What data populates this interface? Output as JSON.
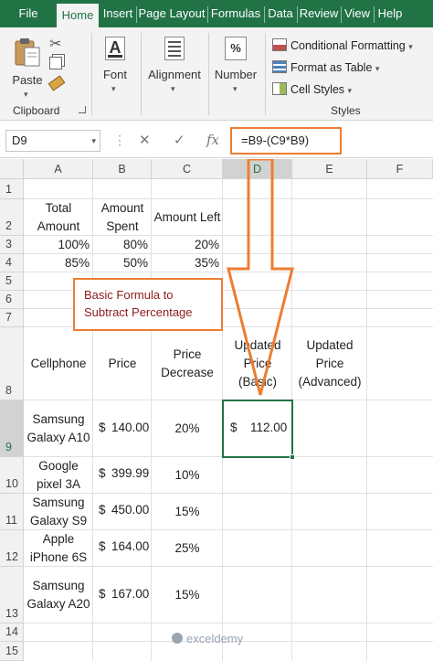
{
  "ribbon": {
    "tabs": [
      "File",
      "Home",
      "Insert",
      "Page Layout",
      "Formulas",
      "Data",
      "Review",
      "View",
      "Help"
    ],
    "active_tab": "Home",
    "clipboard": {
      "paste": "Paste",
      "group": "Clipboard"
    },
    "font": {
      "label": "Font"
    },
    "alignment": {
      "label": "Alignment"
    },
    "number": {
      "label": "Number",
      "symbol": "%"
    },
    "styles": {
      "conditional_formatting": "Conditional Formatting",
      "format_as_table": "Format as Table",
      "cell_styles": "Cell Styles",
      "group": "Styles"
    }
  },
  "formula_bar": {
    "name_box": "D9",
    "fx": "fx",
    "formula": "=B9-(C9*B9)"
  },
  "grid": {
    "columns": [
      "A",
      "B",
      "C",
      "D",
      "E",
      "F"
    ],
    "rows": [
      "1",
      "2",
      "3",
      "4",
      "5",
      "6",
      "7",
      "8",
      "9",
      "10",
      "11",
      "12",
      "13",
      "14",
      "15"
    ],
    "header_row2": {
      "a": "Total Amount",
      "b": "Amount Spent",
      "c": "Amount Left"
    },
    "row3": {
      "a": "100%",
      "b": "80%",
      "c": "20%"
    },
    "row4": {
      "a": "85%",
      "b": "50%",
      "c": "35%"
    },
    "header_row8": {
      "a": "Cellphone",
      "b": "Price",
      "c": "Price Decrease",
      "d": "Updated Price (Basic)",
      "e": "Updated Price (Advanced)"
    },
    "products": [
      {
        "name": "Samsung Galaxy A10",
        "price": "140.00",
        "decrease": "20%"
      },
      {
        "name": "Google pixel 3A",
        "price": "399.99",
        "decrease": "10%"
      },
      {
        "name": "Samsung Galaxy S9",
        "price": "450.00",
        "decrease": "15%"
      },
      {
        "name": "Apple iPhone 6S",
        "price": "164.00",
        "decrease": "25%"
      },
      {
        "name": "Samsung Galaxy A20",
        "price": "167.00",
        "decrease": "15%"
      }
    ],
    "currency": "$",
    "d9_value": "112.00"
  },
  "callout": {
    "text": "Basic Formula to Subtract Percentage"
  },
  "watermark": {
    "text": "exceldemy"
  },
  "colors": {
    "excel_green": "#217346",
    "callout_orange": "#ed7d31",
    "callout_text": "#8b1a1a"
  }
}
